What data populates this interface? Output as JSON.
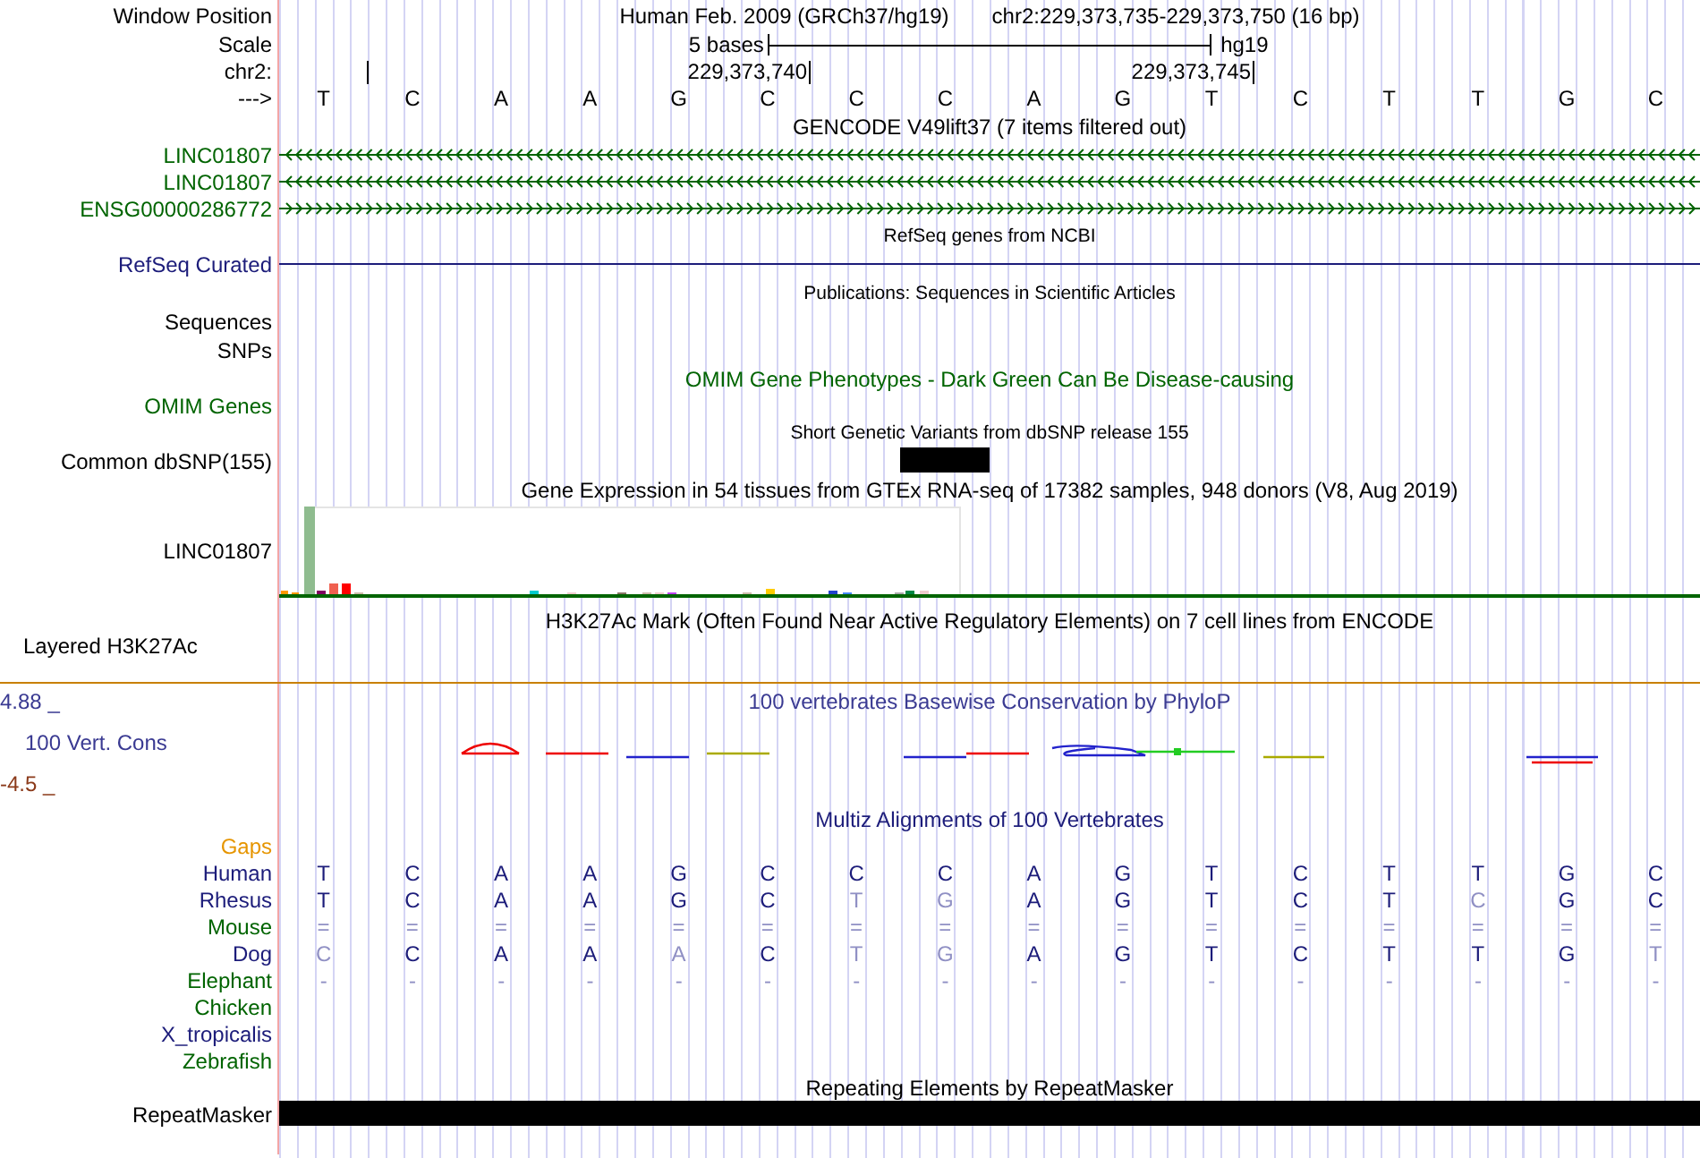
{
  "position": {
    "label": "Window Position",
    "assembly": "Human Feb. 2009 (GRCh37/hg19)",
    "range": "chr2:229,373,735-229,373,750 (16 bp)"
  },
  "scale": {
    "label": "Scale",
    "bar_label": "5 bases",
    "assembly": "hg19"
  },
  "chrom": {
    "label": "chr2:",
    "ticks": [
      "229,373,740",
      "229,373,745"
    ]
  },
  "sequence": {
    "label": "--->",
    "bases": [
      "T",
      "C",
      "A",
      "A",
      "G",
      "C",
      "C",
      "C",
      "A",
      "G",
      "T",
      "C",
      "T",
      "T",
      "G",
      "C"
    ]
  },
  "gencode": {
    "title": "GENCODE V49lift37 (7 items filtered out)",
    "genes": [
      {
        "name": "LINC01807",
        "kind": "reverse"
      },
      {
        "name": "LINC01807",
        "kind": "reverse"
      },
      {
        "name": "ENSG00000286772",
        "kind": "forward"
      }
    ]
  },
  "refseq": {
    "title": "RefSeq genes from NCBI",
    "label": "RefSeq Curated"
  },
  "publications": {
    "title": "Publications: Sequences in Scientific Articles",
    "labels": [
      "Sequences",
      "SNPs"
    ]
  },
  "omim": {
    "title": "OMIM Gene Phenotypes - Dark Green Can Be Disease-causing",
    "label": "OMIM Genes"
  },
  "dbsnp": {
    "title": "Short Genetic Variants from dbSNP release 155",
    "label": "Common dbSNP(155)"
  },
  "gtex": {
    "title": "Gene Expression in 54 tissues from GTEx RNA-seq of 17382 samples, 948 donors (V8, Aug 2019)",
    "label": "LINC01807"
  },
  "h3k27ac": {
    "title": "H3K27Ac Mark (Often Found Near Active Regulatory Elements) on 7 cell lines from ENCODE",
    "label": "Layered H3K27Ac"
  },
  "phylop": {
    "title": "100 vertebrates Basewise Conservation by PhyloP",
    "label": "100 Vert. Cons",
    "max": "4.88 _",
    "min": "-4.5 _"
  },
  "multiz": {
    "title": "Multiz Alignments of 100 Vertebrates",
    "species": [
      {
        "name": "Gaps",
        "color": "#e69500"
      },
      {
        "name": "Human",
        "color": "#1c1c7a",
        "cells": [
          {
            "b": "T",
            "dim": false
          },
          {
            "b": "C",
            "dim": false
          },
          {
            "b": "A",
            "dim": false
          },
          {
            "b": "A",
            "dim": false
          },
          {
            "b": "G",
            "dim": false
          },
          {
            "b": "C",
            "dim": false
          },
          {
            "b": "C",
            "dim": false
          },
          {
            "b": "C",
            "dim": false
          },
          {
            "b": "A",
            "dim": false
          },
          {
            "b": "G",
            "dim": false
          },
          {
            "b": "T",
            "dim": false
          },
          {
            "b": "C",
            "dim": false
          },
          {
            "b": "T",
            "dim": false
          },
          {
            "b": "T",
            "dim": false
          },
          {
            "b": "G",
            "dim": false
          },
          {
            "b": "C",
            "dim": false
          }
        ]
      },
      {
        "name": "Rhesus",
        "color": "#1c1c7a",
        "cells": [
          {
            "b": "T",
            "dim": false
          },
          {
            "b": "C",
            "dim": false
          },
          {
            "b": "A",
            "dim": false
          },
          {
            "b": "A",
            "dim": false
          },
          {
            "b": "G",
            "dim": false
          },
          {
            "b": "C",
            "dim": false
          },
          {
            "b": "T",
            "dim": true
          },
          {
            "b": "G",
            "dim": true
          },
          {
            "b": "A",
            "dim": false
          },
          {
            "b": "G",
            "dim": false
          },
          {
            "b": "T",
            "dim": false
          },
          {
            "b": "C",
            "dim": false
          },
          {
            "b": "T",
            "dim": false
          },
          {
            "b": "C",
            "dim": true
          },
          {
            "b": "G",
            "dim": false
          },
          {
            "b": "C",
            "dim": false
          }
        ]
      },
      {
        "name": "Mouse",
        "color": "#006400",
        "cells": [
          {
            "b": "=",
            "dim": true
          },
          {
            "b": "=",
            "dim": true
          },
          {
            "b": "=",
            "dim": true
          },
          {
            "b": "=",
            "dim": true
          },
          {
            "b": "=",
            "dim": true
          },
          {
            "b": "=",
            "dim": true
          },
          {
            "b": "=",
            "dim": true
          },
          {
            "b": "=",
            "dim": true
          },
          {
            "b": "=",
            "dim": true
          },
          {
            "b": "=",
            "dim": true
          },
          {
            "b": "=",
            "dim": true
          },
          {
            "b": "=",
            "dim": true
          },
          {
            "b": "=",
            "dim": true
          },
          {
            "b": "=",
            "dim": true
          },
          {
            "b": "=",
            "dim": true
          },
          {
            "b": "=",
            "dim": true
          }
        ]
      },
      {
        "name": "Dog",
        "color": "#1c1c7a",
        "cells": [
          {
            "b": "C",
            "dim": true
          },
          {
            "b": "C",
            "dim": false
          },
          {
            "b": "A",
            "dim": false
          },
          {
            "b": "A",
            "dim": false
          },
          {
            "b": "A",
            "dim": true
          },
          {
            "b": "C",
            "dim": false
          },
          {
            "b": "T",
            "dim": true
          },
          {
            "b": "G",
            "dim": true
          },
          {
            "b": "A",
            "dim": false
          },
          {
            "b": "G",
            "dim": false
          },
          {
            "b": "T",
            "dim": false
          },
          {
            "b": "C",
            "dim": false
          },
          {
            "b": "T",
            "dim": false
          },
          {
            "b": "T",
            "dim": false
          },
          {
            "b": "G",
            "dim": false
          },
          {
            "b": "T",
            "dim": true
          }
        ]
      },
      {
        "name": "Elephant",
        "color": "#006400",
        "cells": [
          {
            "b": "-",
            "dim": true
          },
          {
            "b": "-",
            "dim": true
          },
          {
            "b": "-",
            "dim": true
          },
          {
            "b": "-",
            "dim": true
          },
          {
            "b": "-",
            "dim": true
          },
          {
            "b": "-",
            "dim": true
          },
          {
            "b": "-",
            "dim": true
          },
          {
            "b": "-",
            "dim": true
          },
          {
            "b": "-",
            "dim": true
          },
          {
            "b": "-",
            "dim": true
          },
          {
            "b": "-",
            "dim": true
          },
          {
            "b": "-",
            "dim": true
          },
          {
            "b": "-",
            "dim": true
          },
          {
            "b": "-",
            "dim": true
          },
          {
            "b": "-",
            "dim": true
          },
          {
            "b": "-",
            "dim": true
          }
        ]
      },
      {
        "name": "Chicken",
        "color": "#006400"
      },
      {
        "name": "X_tropicalis",
        "color": "#1c1c7a"
      },
      {
        "name": "Zebrafish",
        "color": "#006400"
      }
    ]
  },
  "repeatmasker": {
    "title": "Repeating Elements by RepeatMasker",
    "label": "RepeatMasker"
  }
}
